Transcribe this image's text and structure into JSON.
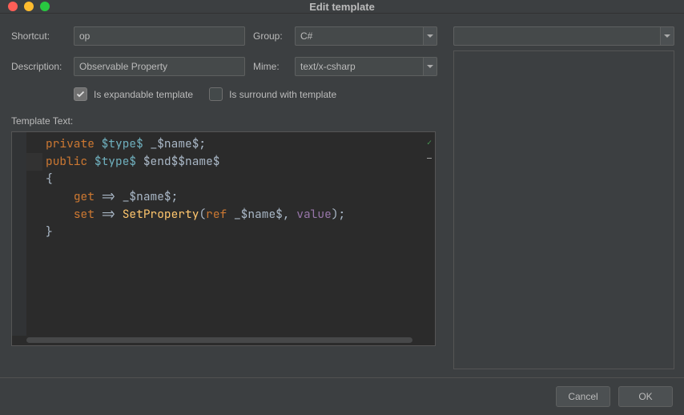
{
  "window": {
    "title": "Edit template"
  },
  "form": {
    "shortcut": {
      "label": "Shortcut:",
      "value": "op"
    },
    "group": {
      "label": "Group:",
      "value": "C#"
    },
    "description": {
      "label": "Description:",
      "value": "Observable Property"
    },
    "mime": {
      "label": "Mime:",
      "value": "text/x-csharp"
    },
    "expandable": {
      "label": "Is expandable template",
      "checked": true
    },
    "surround": {
      "label": "Is surround with template",
      "checked": false
    }
  },
  "editor": {
    "label": "Template Text:",
    "tokens": {
      "kw_private": "private",
      "kw_public": "public",
      "kw_get": "get",
      "kw_set": "set",
      "kw_ref": "ref",
      "tp_type": "$type$",
      "v_uname": "_$name$",
      "v_end": "$end$",
      "v_name": "$name$",
      "m_setprop": "SetProperty",
      "kw_value": "value",
      "semi": ";",
      "arrow": "=>",
      "obrace": "{",
      "cbrace": "}",
      "oparen": "(",
      "cparen": ")",
      "comma": ","
    }
  },
  "buttons": {
    "cancel": "Cancel",
    "ok": "OK"
  }
}
